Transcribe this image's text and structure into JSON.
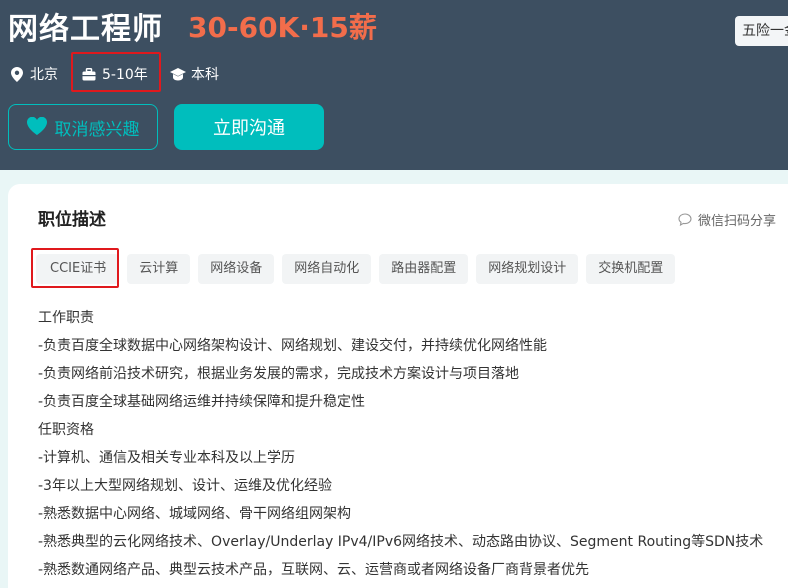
{
  "job": {
    "title": "网络工程师",
    "salary": "30-60K·15薪",
    "benefit_tag": "五险一金",
    "city": "北京",
    "experience": "5-10年",
    "education": "本科"
  },
  "actions": {
    "unfollow_label": "取消感兴趣",
    "chat_label": "立即沟通"
  },
  "section": {
    "title": "职位描述",
    "share_label": "微信扫码分享"
  },
  "tags": [
    "CCIE证书",
    "云计算",
    "网络设备",
    "网络自动化",
    "路由器配置",
    "网络规划设计",
    "交换机配置"
  ],
  "description": [
    "工作职责",
    "-负责百度全球数据中心网络架构设计、网络规划、建设交付，并持续优化网络性能",
    "-负责网络前沿技术研究，根据业务发展的需求，完成技术方案设计与项目落地",
    "-负责百度全球基础网络运维并持续保障和提升稳定性",
    "任职资格",
    "-计算机、通信及相关专业本科及以上学历",
    "-3年以上大型网络规划、设计、运维及优化经验",
    "-熟悉数据中心网络、城域网络、骨干网络组网架构",
    "-熟悉典型的云化网络技术、Overlay/Underlay IPv4/IPv6网络技术、动态路由协议、Segment Routing等SDN技术",
    "-熟悉数通网络产品、典型云技术产品，互联网、云、运营商或者网络设备厂商背景者优先"
  ],
  "colors": {
    "header_bg": "#3d4f61",
    "salary": "#f26d4b",
    "accent": "#00bebd",
    "highlight": "#e0191d"
  },
  "icons": [
    "location-icon",
    "briefcase-icon",
    "graduation-cap-icon",
    "heart-icon",
    "chat-bubble-icon"
  ]
}
